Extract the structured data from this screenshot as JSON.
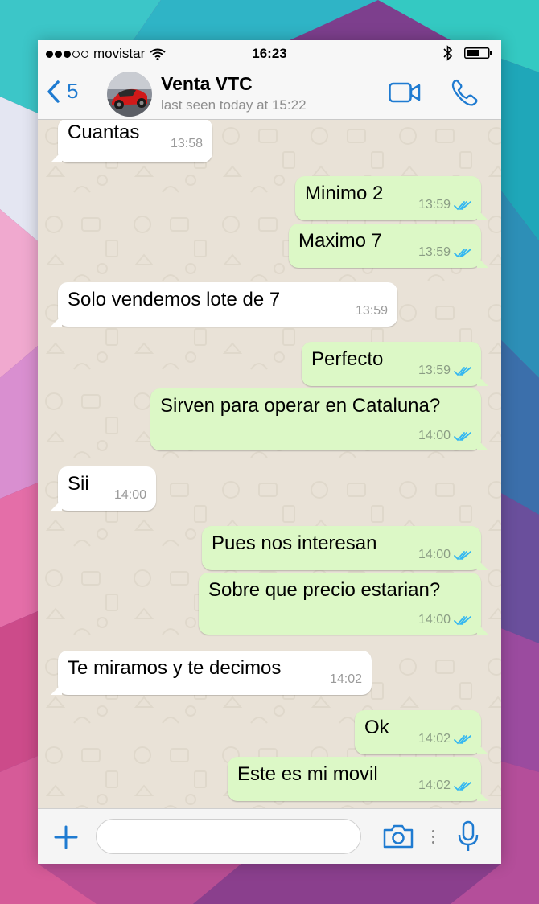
{
  "status_bar": {
    "carrier": "movistar",
    "time": "16:23"
  },
  "header": {
    "back_count": "5",
    "contact_name": "Venta VTC",
    "last_seen": "last seen today at 15:22"
  },
  "messages": [
    {
      "dir": "in",
      "text": "Cuantas",
      "time": "13:58",
      "read": false
    },
    {
      "dir": "out",
      "text": "Minimo 2",
      "time": "13:59",
      "read": true
    },
    {
      "dir": "out",
      "text": "Maximo 7",
      "time": "13:59",
      "read": true
    },
    {
      "dir": "in",
      "text": "Solo vendemos  lote de 7",
      "time": "13:59",
      "read": false
    },
    {
      "dir": "out",
      "text": "Perfecto",
      "time": "13:59",
      "read": true
    },
    {
      "dir": "out",
      "text": "Sirven para operar en Cataluna?",
      "time": "14:00",
      "read": true
    },
    {
      "dir": "in",
      "text": "Sii",
      "time": "14:00",
      "read": false
    },
    {
      "dir": "out",
      "text": "Pues nos interesan",
      "time": "14:00",
      "read": true
    },
    {
      "dir": "out",
      "text": "Sobre que precio estarian?",
      "time": "14:00",
      "read": true
    },
    {
      "dir": "in",
      "text": "Te miramos y te decimos",
      "time": "14:02",
      "read": false
    },
    {
      "dir": "out",
      "text": "Ok",
      "time": "14:02",
      "read": true
    },
    {
      "dir": "out",
      "text": "Este es mi movil",
      "time": "14:02",
      "read": true
    }
  ],
  "input_bar": {
    "placeholder": ""
  },
  "colors": {
    "accent": "#1f7bd1",
    "outgoing_bubble": "#dcf8c6",
    "incoming_bubble": "#ffffff",
    "read_ticks": "#34b7f1",
    "chat_background": "#e9e2d7"
  },
  "icons": [
    "back-chevron-icon",
    "video-call-icon",
    "phone-call-icon",
    "read-ticks-icon",
    "scroll-down-icon",
    "plus-icon",
    "camera-icon",
    "microphone-icon",
    "wifi-icon",
    "bluetooth-icon",
    "battery-icon"
  ]
}
